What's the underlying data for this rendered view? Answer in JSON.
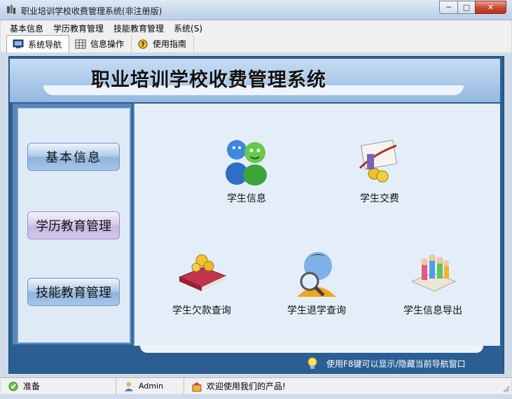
{
  "window": {
    "title": "职业培训学校收费管理系统(非注册版)",
    "controls": {
      "minimize": "─",
      "maximize": "□",
      "close": "✕"
    }
  },
  "menubar": {
    "items": [
      "基本信息",
      "学历教育管理",
      "技能教育管理",
      "系统(S)"
    ]
  },
  "toolbar": {
    "tabs": [
      "系统导航",
      "信息操作",
      "使用指南"
    ]
  },
  "banner": {
    "title": "职业培训学校收费管理系统"
  },
  "sidebar": {
    "buttons": [
      "基本信息",
      "学历教育管理",
      "技能教育管理"
    ]
  },
  "features": {
    "student_info": "学生信息",
    "student_payment": "学生交费",
    "arrears_query": "学生欠款查询",
    "withdrawal_query": "学生退学查询",
    "info_export": "学生信息导出"
  },
  "hint": {
    "text": "使用F8键可以显示/隐藏当前导航窗口"
  },
  "statusbar": {
    "state": "准备",
    "user": "Admin",
    "welcome": "欢迎使用我们的产品!"
  },
  "colors": {
    "frame": "#2b5f94",
    "banner": "#a8c7e8",
    "content": "#e4eef9",
    "sidebar": "#dfeaf7"
  },
  "icons": [
    "app-icon",
    "monitor-icon",
    "grid-icon",
    "help-icon",
    "users-icon",
    "payment-icon",
    "book-coins-icon",
    "search-person-icon",
    "export-people-icon",
    "lightbulb-icon",
    "status-ready-icon",
    "user-status-icon",
    "product-icon"
  ]
}
